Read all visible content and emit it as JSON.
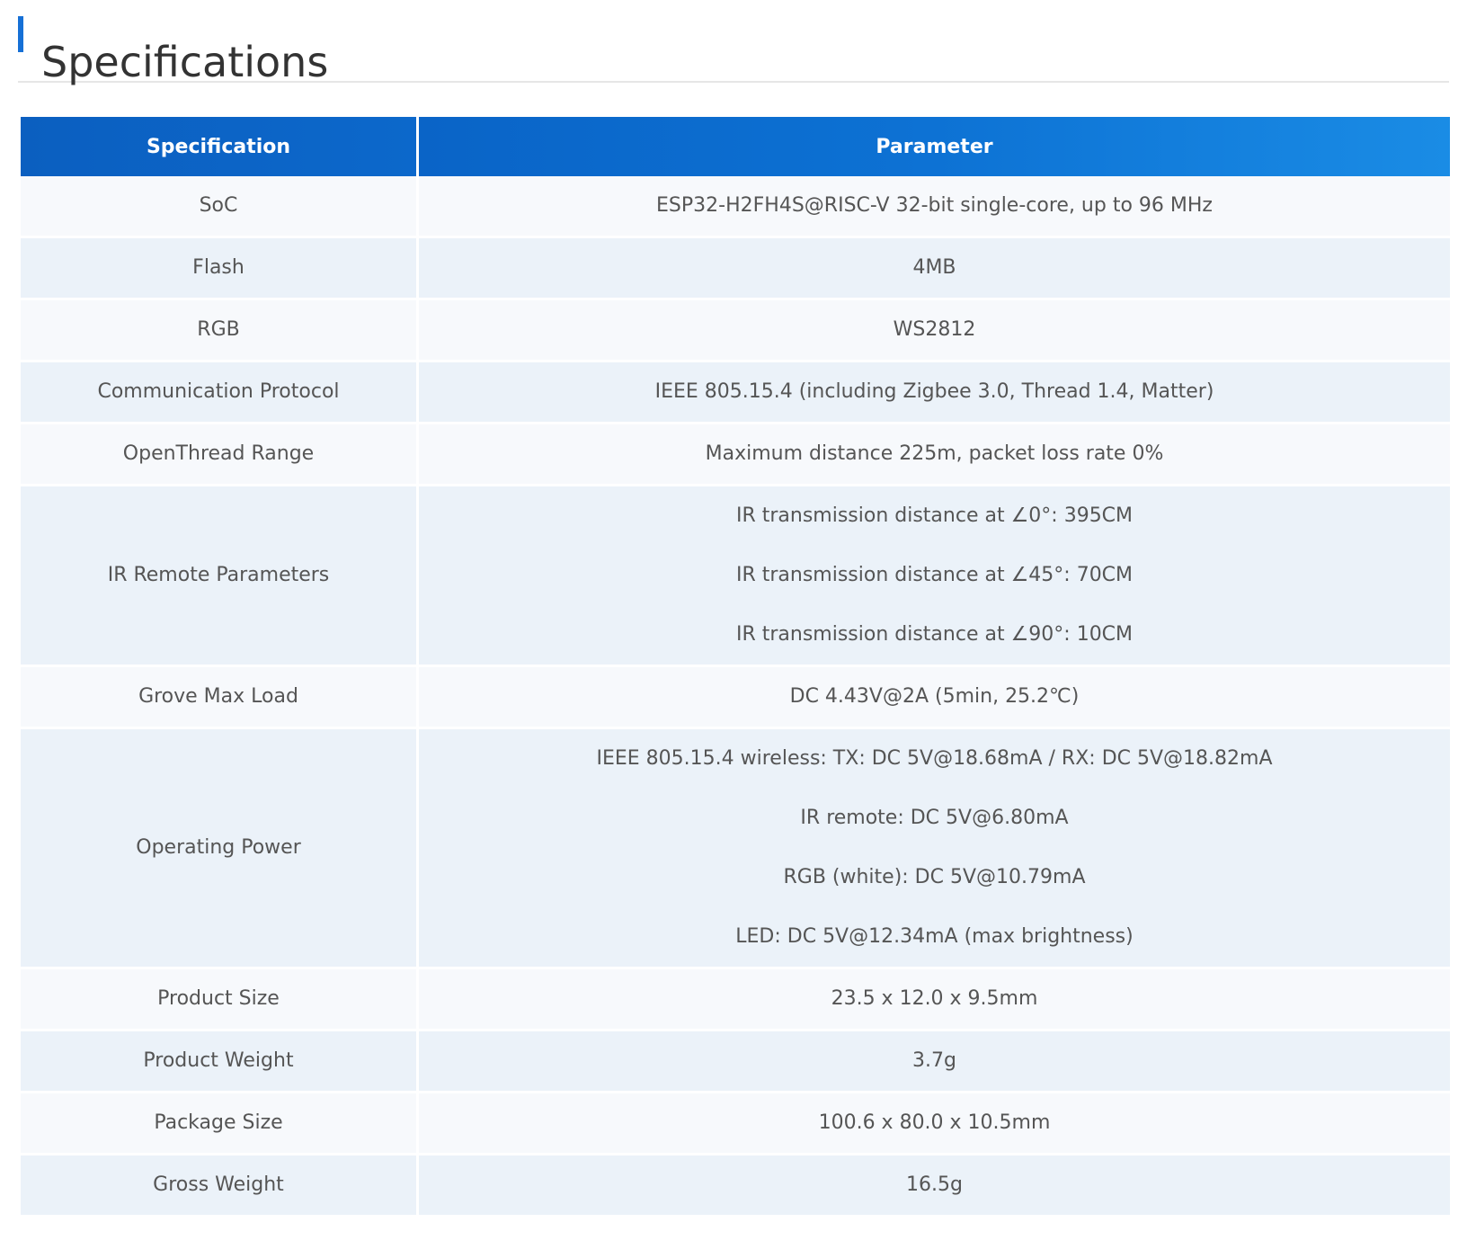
{
  "page": {
    "title": "Specifications"
  },
  "table": {
    "headers": [
      "Specification",
      "Parameter"
    ],
    "rows": [
      {
        "spec": "SoC",
        "params": [
          "ESP32-H2FH4S@RISC-V 32-bit single-core, up to 96 MHz"
        ]
      },
      {
        "spec": "Flash",
        "params": [
          "4MB"
        ]
      },
      {
        "spec": "RGB",
        "params": [
          "WS2812"
        ]
      },
      {
        "spec": "Communication Protocol",
        "params": [
          "IEEE 805.15.4 (including Zigbee 3.0, Thread 1.4, Matter)"
        ]
      },
      {
        "spec": "OpenThread Range",
        "params": [
          "Maximum distance 225m, packet loss rate 0%"
        ]
      },
      {
        "spec": "IR Remote Parameters",
        "params": [
          "IR transmission distance at ∠0°: 395CM",
          "IR transmission distance at ∠45°: 70CM",
          "IR transmission distance at ∠90°: 10CM"
        ]
      },
      {
        "spec": "Grove Max Load",
        "params": [
          "DC 4.43V@2A (5min, 25.2℃)"
        ]
      },
      {
        "spec": "Operating Power",
        "params": [
          "IEEE 805.15.4 wireless: TX: DC 5V@18.68mA / RX: DC 5V@18.82mA",
          "IR remote: DC 5V@6.80mA",
          "RGB (white): DC 5V@10.79mA",
          "LED: DC 5V@12.34mA (max brightness)"
        ]
      },
      {
        "spec": "Product Size",
        "params": [
          "23.5 x 12.0 x 9.5mm"
        ]
      },
      {
        "spec": "Product Weight",
        "params": [
          "3.7g"
        ]
      },
      {
        "spec": "Package Size",
        "params": [
          "100.6 x 80.0 x 10.5mm"
        ]
      },
      {
        "spec": "Gross Weight",
        "params": [
          "16.5g"
        ]
      }
    ]
  },
  "colors": {
    "accent": "#1670d6",
    "header_bg": "#0a6dd0",
    "row_odd": "#f7f9fc",
    "row_even": "#ebf2f9"
  }
}
